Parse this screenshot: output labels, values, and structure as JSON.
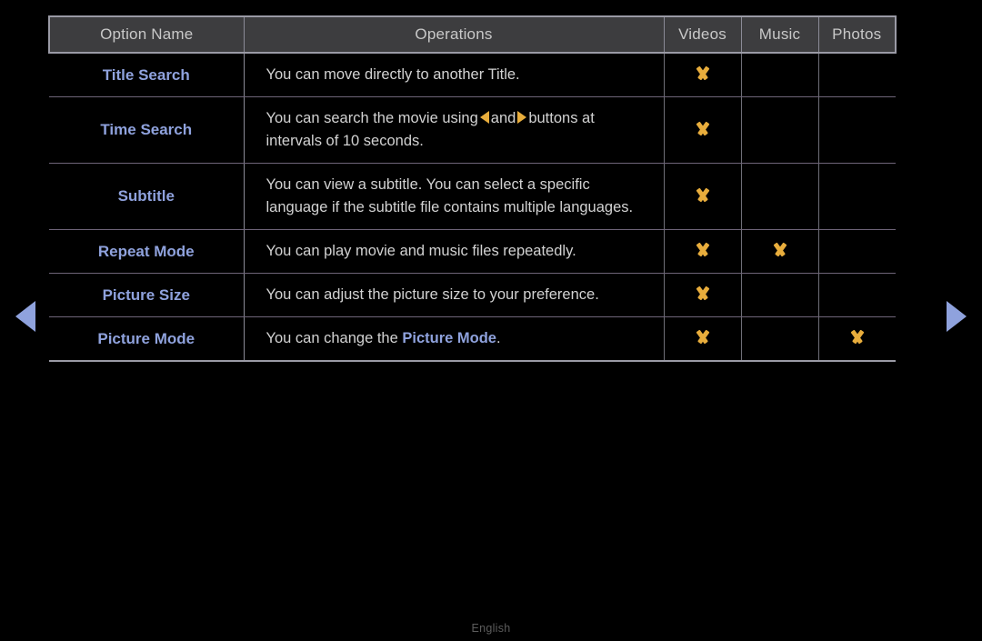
{
  "nav": {
    "left_arrow": "prev-page-arrow",
    "right_arrow": "next-page-arrow"
  },
  "table": {
    "headers": {
      "option_name": "Option Name",
      "operations": "Operations",
      "videos": "Videos",
      "music": "Music",
      "photos": "Photos"
    },
    "rows": [
      {
        "option": "Title Search",
        "operation_text": "You can move directly to another Title.",
        "videos": true,
        "music": false,
        "photos": false
      },
      {
        "option": "Time Search",
        "operation_text": "You can search the movie using ◀ and ▶ buttons at intervals of 10 seconds.",
        "operation_pre": "You can search the movie using",
        "operation_mid": "and",
        "operation_post": "buttons at intervals of 10 seconds.",
        "videos": true,
        "music": false,
        "photos": false
      },
      {
        "option": "Subtitle",
        "operation_text": "You can view a subtitle. You can select a specific language if the subtitle file contains multiple languages.",
        "videos": true,
        "music": false,
        "photos": false
      },
      {
        "option": "Repeat Mode",
        "operation_text": "You can play movie and music files repeatedly.",
        "videos": true,
        "music": true,
        "photos": false
      },
      {
        "option": "Picture Size",
        "operation_text": "You can adjust the picture size to your preference.",
        "videos": true,
        "music": false,
        "photos": false
      },
      {
        "option": "Picture Mode",
        "operation_text": "You can change the Picture Mode.",
        "operation_pre": "You can change the",
        "operation_highlight": "Picture Mode",
        "operation_post": ".",
        "videos": true,
        "music": false,
        "photos": true
      }
    ]
  },
  "footer": {
    "language": "English"
  },
  "colors": {
    "background": "#000000",
    "option_name": "#8fa2dd",
    "check_mark": "#e8ad3c",
    "header_bg": "#3d3d3f",
    "body_text": "#d2d2d2",
    "nav_arrow": "#8fa2dd",
    "footer_text": "#5c5c5c"
  }
}
